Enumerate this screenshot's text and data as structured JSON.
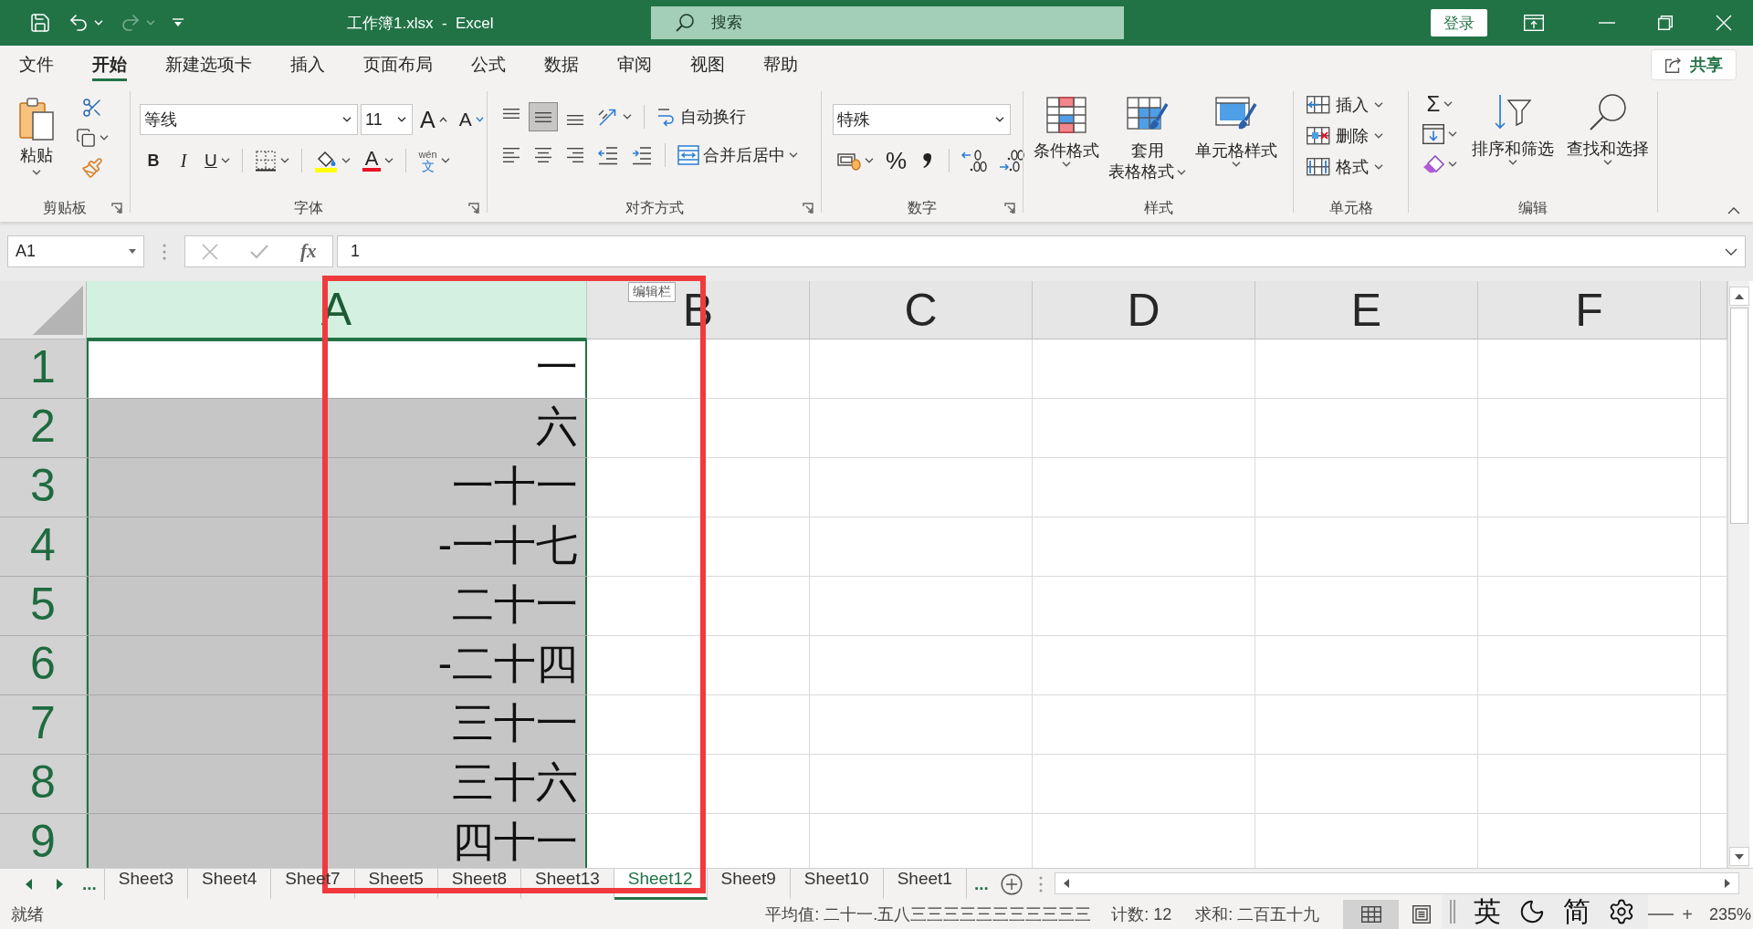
{
  "title_bar": {
    "quick_access": [
      {
        "kind": "save",
        "disabled": false
      },
      {
        "kind": "undo",
        "disabled": false
      },
      {
        "kind": "redo",
        "disabled": true
      },
      {
        "kind": "customize",
        "disabled": false
      }
    ],
    "title": "工作簿1.xlsx  -  Excel",
    "search": {
      "placeholder": "搜索"
    },
    "sign_in": "登录"
  },
  "ribbon_tabs": [
    {
      "label": "文件",
      "selected": false
    },
    {
      "label": "开始",
      "selected": true
    },
    {
      "label": "新建选项卡",
      "selected": false
    },
    {
      "label": "插入",
      "selected": false
    },
    {
      "label": "页面布局",
      "selected": false
    },
    {
      "label": "公式",
      "selected": false
    },
    {
      "label": "数据",
      "selected": false
    },
    {
      "label": "审阅",
      "selected": false
    },
    {
      "label": "视图",
      "selected": false
    },
    {
      "label": "帮助",
      "selected": false
    }
  ],
  "share_button": "共享",
  "ribbon": {
    "clipboard": {
      "label": "剪贴板",
      "paste": "粘贴"
    },
    "font": {
      "label": "字体",
      "font_name": "等线",
      "font_size": "11",
      "grow": "A",
      "shrink": "A",
      "bold": "B",
      "italic": "I",
      "underline": "U",
      "font_color": "A",
      "phonetic": "wén",
      "phonetic_char": "文"
    },
    "alignment": {
      "label": "对齐方式",
      "vertical": [
        {
          "kind": "top",
          "selected": false
        },
        {
          "kind": "middle",
          "selected": true
        },
        {
          "kind": "bottom",
          "selected": false
        }
      ],
      "wrap_text": "自动换行",
      "horizontal": [
        {
          "kind": "left",
          "selected": false
        },
        {
          "kind": "center",
          "selected": false
        },
        {
          "kind": "right",
          "selected": false
        }
      ],
      "merge": "合并后居中"
    },
    "number": {
      "label": "数字",
      "format": "特殊",
      "percent": "%"
    },
    "styles": {
      "label": "样式",
      "items": [
        {
          "kind": "conditional",
          "lines": [
            "条件格式"
          ]
        },
        {
          "kind": "table",
          "lines": [
            "套用",
            "表格格式"
          ]
        },
        {
          "kind": "cell",
          "lines": [
            "单元格样式"
          ]
        }
      ]
    },
    "cells": {
      "label": "单元格",
      "items": [
        {
          "kind": "insert",
          "label": "插入"
        },
        {
          "kind": "delete",
          "label": "删除"
        },
        {
          "kind": "format",
          "label": "格式"
        }
      ]
    },
    "editing": {
      "label": "编辑",
      "sum": "Σ",
      "items": [
        {
          "kind": "sort",
          "label": "排序和筛选"
        },
        {
          "kind": "find",
          "label": "查找和选择"
        }
      ]
    }
  },
  "formula_bar": {
    "name_box": "A1",
    "buttons": [
      {
        "kind": "cancel",
        "disabled": true
      },
      {
        "kind": "enter",
        "disabled": true
      }
    ],
    "fx": "fx",
    "value": "1",
    "tooltip": "编辑栏"
  },
  "sheet": {
    "columns": [
      {
        "label": "A",
        "selected": true
      },
      {
        "label": "B",
        "selected": false
      },
      {
        "label": "C",
        "selected": false
      },
      {
        "label": "D",
        "selected": false
      },
      {
        "label": "E",
        "selected": false
      },
      {
        "label": "F",
        "selected": false
      }
    ],
    "rows": [
      {
        "header": "1",
        "value": "一",
        "selected": true,
        "active": true
      },
      {
        "header": "2",
        "value": "六",
        "selected": true,
        "active": false
      },
      {
        "header": "3",
        "value": "一十一",
        "selected": true,
        "active": false
      },
      {
        "header": "4",
        "value": "-一十七",
        "selected": true,
        "active": false
      },
      {
        "header": "5",
        "value": "二十一",
        "selected": true,
        "active": false
      },
      {
        "header": "6",
        "value": "-二十四",
        "selected": true,
        "active": false
      },
      {
        "header": "7",
        "value": "三十一",
        "selected": true,
        "active": false
      },
      {
        "header": "8",
        "value": "三十六",
        "selected": true,
        "active": false
      },
      {
        "header": "9",
        "value": "四十一",
        "selected": true,
        "active": false
      }
    ]
  },
  "sheet_tabs": {
    "overflow_left": "...",
    "tabs": [
      {
        "label": "Sheet3",
        "selected": false
      },
      {
        "label": "Sheet4",
        "selected": false
      },
      {
        "label": "Sheet7",
        "selected": false
      },
      {
        "label": "Sheet5",
        "selected": false
      },
      {
        "label": "Sheet8",
        "selected": false
      },
      {
        "label": "Sheet13",
        "selected": false
      },
      {
        "label": "Sheet12",
        "selected": true
      },
      {
        "label": "Sheet9",
        "selected": false
      },
      {
        "label": "Sheet10",
        "selected": false
      },
      {
        "label": "Sheet1",
        "selected": false
      }
    ],
    "overflow_right": "..."
  },
  "status_bar": {
    "ready": "就绪",
    "average": "平均值: 二十一.五八三三三三三三三三三三三",
    "count": "计数: 12",
    "sum": "求和: 二百五十九",
    "views": [
      {
        "kind": "normal",
        "selected": true
      },
      {
        "kind": "page_layout",
        "selected": false
      }
    ],
    "zoom_in": "+",
    "zoom": "235%"
  },
  "ime_bar": {
    "language": "英",
    "script": "简"
  }
}
